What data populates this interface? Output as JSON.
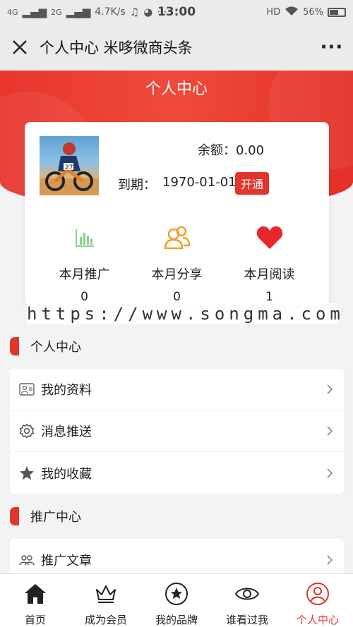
{
  "status_bar": {
    "net1": "4G",
    "net2": "2G",
    "speed": "4.7K/s",
    "time": "13:00",
    "hd": "HD",
    "battery": "56%"
  },
  "title_bar": {
    "title": "个人中心 米哆微商头条",
    "more": "···"
  },
  "header": {
    "title": "个人中心"
  },
  "profile": {
    "balance": "余额：0.00",
    "expire_label": "到期：",
    "expire_date": "1970-01-01",
    "open_button": "开通",
    "stats": [
      {
        "label": "本月推广",
        "value": "0",
        "icon": "bar-chart-icon",
        "color": "#8fd18a"
      },
      {
        "label": "本月分享",
        "value": "0",
        "icon": "users-icon",
        "color": "#f0a22b"
      },
      {
        "label": "本月阅读",
        "value": "1",
        "icon": "heart-icon",
        "color": "#e8262d"
      }
    ]
  },
  "watermark": "https://www.songma.com",
  "sections": {
    "personal": {
      "title": "个人中心",
      "items": [
        {
          "label": "我的资料",
          "icon": "id-card-icon"
        },
        {
          "label": "消息推送",
          "icon": "gear-icon"
        },
        {
          "label": "我的收藏",
          "icon": "star-icon"
        }
      ]
    },
    "promotion": {
      "title": "推广中心",
      "items": [
        {
          "label": "推广文章",
          "icon": "team-icon"
        }
      ]
    }
  },
  "bottom_nav": [
    {
      "label": "首页",
      "icon": "home-icon",
      "active": false
    },
    {
      "label": "成为会员",
      "icon": "crown-icon",
      "active": false
    },
    {
      "label": "我的品牌",
      "icon": "badge-icon",
      "active": false
    },
    {
      "label": "谁看过我",
      "icon": "eye-icon",
      "active": false
    },
    {
      "label": "个人中心",
      "icon": "user-circle-icon",
      "active": true
    }
  ],
  "colors": {
    "accent": "#e2352b",
    "header_red": "#ec3f33"
  }
}
